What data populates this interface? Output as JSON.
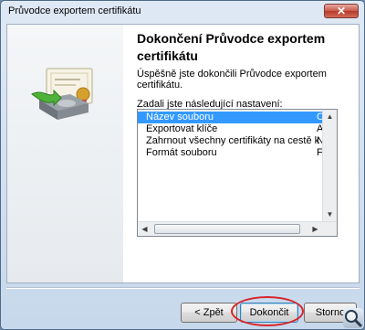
{
  "window": {
    "title": "Průvodce exportem certifikátu"
  },
  "titlebar": {
    "close_icon": "close-icon",
    "close_glyph": "✕"
  },
  "page": {
    "heading": "Dokončení Průvodce exportem certifikátu",
    "success_text": "Úspěšně jste dokončili Průvodce exportem certifikátu.",
    "settings_label": "Zadali jste následující nastavení:"
  },
  "settings_list": {
    "rows": [
      {
        "name": "Název souboru",
        "value": "C:",
        "selected": true
      },
      {
        "name": "Exportovat klíče",
        "value": "Ar",
        "selected": false
      },
      {
        "name": "Zahrnout všechny certifikáty na cestě k certifikátu",
        "value": "Ne",
        "selected": false
      },
      {
        "name": "Formát souboru",
        "value": "Fo",
        "selected": false
      }
    ]
  },
  "buttons": {
    "back": "< Zpět",
    "finish": "Dokončit",
    "cancel": "Storno"
  },
  "colors": {
    "selection": "#3399ff",
    "highlight_ellipse": "#d9252a",
    "close_button": "#c95a4b"
  },
  "icons": {
    "wizard": "certificate-export-icon",
    "magnifier": "magnifier-icon"
  }
}
